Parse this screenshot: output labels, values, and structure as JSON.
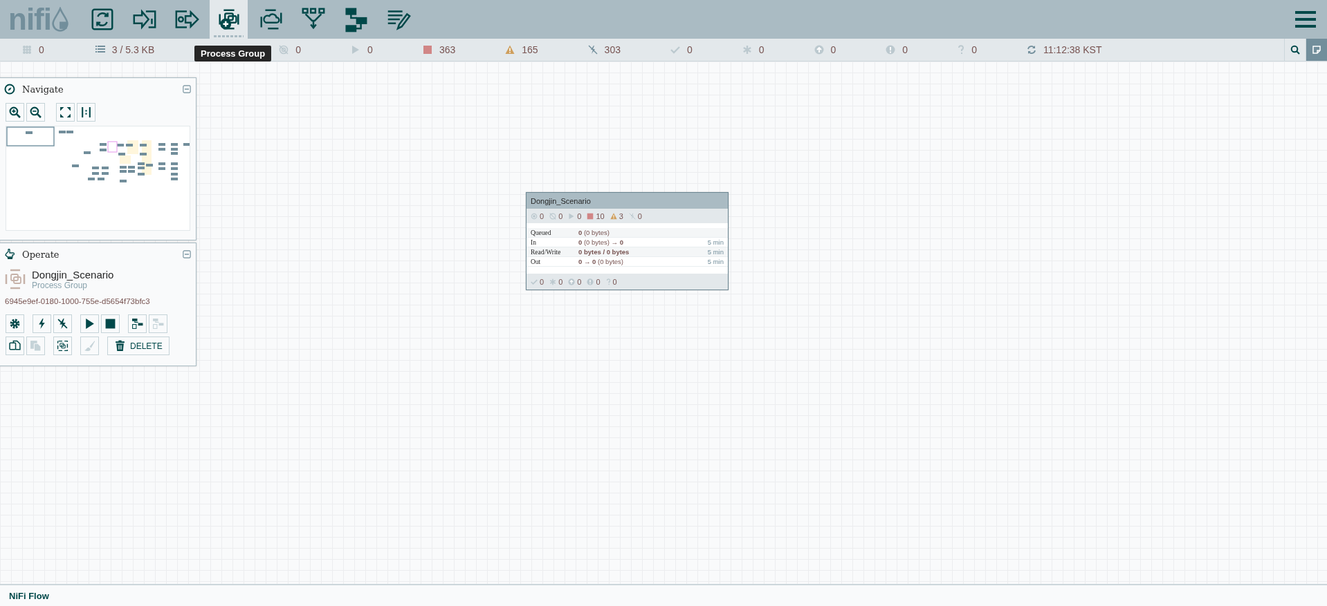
{
  "toolbar": {
    "logo": "nifi",
    "tools": [
      {
        "kind": "processor",
        "selected": false
      },
      {
        "kind": "input-port",
        "selected": false
      },
      {
        "kind": "output-port",
        "selected": false
      },
      {
        "kind": "process-group",
        "selected": true
      },
      {
        "kind": "remote-process-group",
        "selected": false
      },
      {
        "kind": "funnel",
        "selected": false
      },
      {
        "kind": "template",
        "selected": false
      },
      {
        "kind": "label",
        "selected": false
      }
    ],
    "tooltip": "Process Group"
  },
  "status_bar": {
    "left": [
      {
        "kind": "cluster",
        "value": "0"
      },
      {
        "kind": "queued",
        "value": "3 / 5.3 KB"
      }
    ],
    "right": [
      {
        "kind": "not-transmitting",
        "value": "0"
      },
      {
        "kind": "running",
        "value": "0"
      },
      {
        "kind": "stopped",
        "value": "363"
      },
      {
        "kind": "invalid",
        "value": "165"
      },
      {
        "kind": "disabled",
        "value": "303"
      },
      {
        "kind": "up-to-date",
        "value": "0"
      },
      {
        "kind": "modified",
        "value": "0"
      },
      {
        "kind": "stale",
        "value": "0"
      },
      {
        "kind": "modified-stale",
        "value": "0"
      },
      {
        "kind": "sync-failure",
        "value": "0"
      },
      {
        "kind": "refresh",
        "value": "11:12:38 KST"
      }
    ]
  },
  "navigate": {
    "title": "Navigate"
  },
  "operate": {
    "title": "Operate",
    "name": "Dongjin_Scenario",
    "type": "Process Group",
    "id": "6945e9ef-0180-1000-755e-d5654f73bfc3",
    "rows": [
      [
        {
          "kind": "configure",
          "disabled": false
        },
        {
          "kind": "enable",
          "disabled": false
        },
        {
          "kind": "disable",
          "disabled": false
        },
        {
          "kind": "start",
          "disabled": false
        },
        {
          "kind": "stop",
          "disabled": false
        },
        {
          "kind": "save-template",
          "disabled": false
        },
        {
          "kind": "upload-template",
          "disabled": true
        }
      ],
      [
        {
          "kind": "copy",
          "disabled": false
        },
        {
          "kind": "paste",
          "disabled": true
        },
        {
          "kind": "group",
          "disabled": false
        },
        {
          "kind": "color",
          "disabled": true
        },
        {
          "kind": "delete",
          "disabled": false,
          "label": "DELETE"
        }
      ]
    ]
  },
  "process_group": {
    "name": "Dongjin_Scenario",
    "counts": [
      {
        "kind": "transmitting",
        "value": "0"
      },
      {
        "kind": "not-transmitting",
        "value": "0"
      },
      {
        "kind": "running",
        "value": "0"
      },
      {
        "kind": "stopped",
        "value": "10"
      },
      {
        "kind": "invalid",
        "value": "3"
      },
      {
        "kind": "disabled",
        "value": "0"
      }
    ],
    "stats": [
      {
        "label": "Queued",
        "value": "**0** (0 bytes)",
        "strong": false
      },
      {
        "label": "In",
        "value": "**0** (0 bytes) → **0**",
        "strong": false,
        "period": "5 min"
      },
      {
        "label": "Read/Write",
        "value": "0 bytes / 0 bytes",
        "strong": true,
        "period": "5 min"
      },
      {
        "label": "Out",
        "value": "**0** → **0** (0 bytes)",
        "strong": false,
        "period": "5 min"
      }
    ],
    "versions": [
      {
        "kind": "up-to-date",
        "value": "0"
      },
      {
        "kind": "modified",
        "value": "0"
      },
      {
        "kind": "stale",
        "value": "0"
      },
      {
        "kind": "modified-stale",
        "value": "0"
      },
      {
        "kind": "sync-failure",
        "value": "0"
      }
    ]
  },
  "footer": {
    "breadcrumb": "NiFi Flow"
  }
}
